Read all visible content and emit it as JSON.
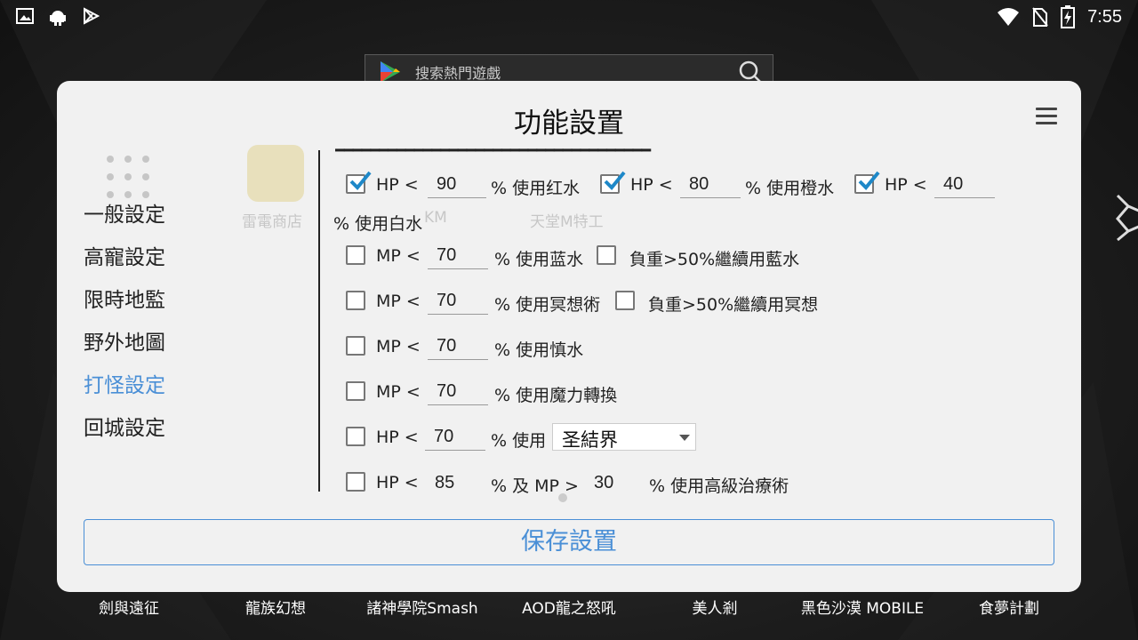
{
  "status_bar": {
    "time": "7:55",
    "left_icons": [
      "gallery-icon",
      "android-icon",
      "play-store-icon"
    ],
    "right_icons": [
      "wifi-icon",
      "no-sim-icon",
      "battery-charging-icon"
    ]
  },
  "background": {
    "search_placeholder": "搜索熱門遊戲",
    "ghost_apps": [
      "雷電商店",
      "KM",
      "天堂M特工"
    ],
    "dock_apps": [
      "劍與遠征",
      "龍族幻想",
      "諸神學院Smash",
      "AOD龍之怒吼",
      "美人剎",
      "黑色沙漠 MOBILE",
      "食夢計劃"
    ]
  },
  "dialog": {
    "title": "功能設置",
    "menu_icon": "hamburger-menu-icon",
    "nav": [
      {
        "label": "一般設定",
        "active": false
      },
      {
        "label": "高寵設定",
        "active": false
      },
      {
        "label": "限時地監",
        "active": false
      },
      {
        "label": "野外地圖",
        "active": false
      },
      {
        "label": "打怪設定",
        "active": true
      },
      {
        "label": "回城設定",
        "active": false
      }
    ],
    "rows": {
      "r1": {
        "a": {
          "checked": true,
          "prefix": "HP <",
          "value": "90",
          "suffix": "% 使用红水"
        },
        "b": {
          "checked": true,
          "prefix": "HP <",
          "value": "80",
          "suffix": "% 使用橙水"
        },
        "c": {
          "checked": true,
          "prefix": "HP <",
          "value": "40",
          "suffix": "% 使用白水"
        }
      },
      "r2": {
        "checked": false,
        "prefix": "MP <",
        "value": "70",
        "suffix": "% 使用蓝水",
        "extra_checked": false,
        "extra_label": "負重>50%繼續用藍水"
      },
      "r3": {
        "checked": false,
        "prefix": "MP <",
        "value": "70",
        "suffix": "% 使用冥想術",
        "extra_checked": false,
        "extra_label": "負重>50%繼續用冥想"
      },
      "r4": {
        "checked": false,
        "prefix": "MP <",
        "value": "70",
        "suffix": "% 使用慎水"
      },
      "r5": {
        "checked": false,
        "prefix": "MP <",
        "value": "70",
        "suffix": "% 使用魔力轉換"
      },
      "r6": {
        "checked": false,
        "prefix": "HP <",
        "value": "70",
        "suffix": "% 使用",
        "select_value": "圣結界"
      },
      "r7": {
        "checked": false,
        "prefix": "HP <",
        "hp_value": "85",
        "mid": "% 及 MP >",
        "mp_value": "30",
        "suffix": "% 使用高級治療術"
      }
    },
    "save_label": "保存設置",
    "accent_color": "#4a8fd6",
    "checkbox_color": "#1e88c8"
  }
}
